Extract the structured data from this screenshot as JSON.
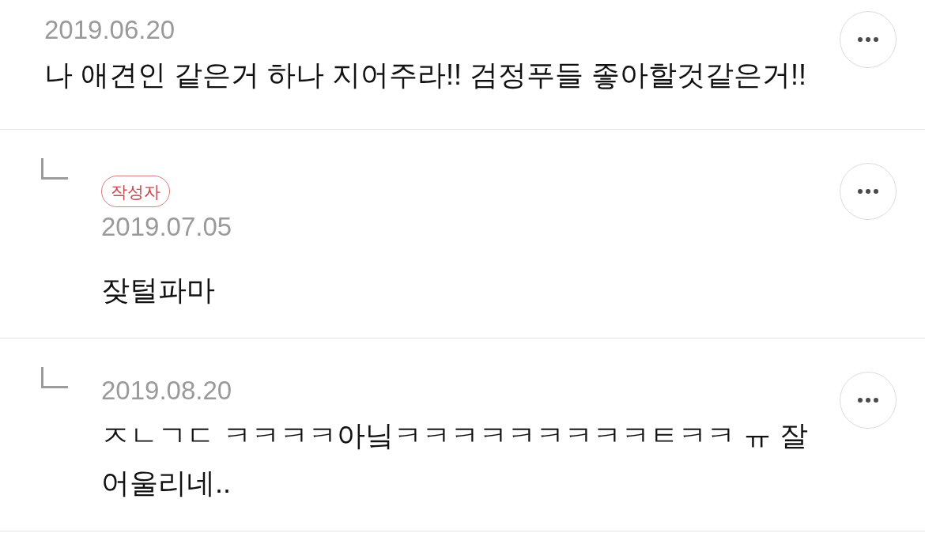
{
  "comments": [
    {
      "kind": "comment",
      "date": "2019.06.20",
      "text": "나 애견인 같은거 하나 지어주라!! 검정푸들 좋아할것같은거!!"
    },
    {
      "kind": "reply",
      "badge": "작성자",
      "date": "2019.07.05",
      "text": "잦털파마"
    },
    {
      "kind": "reply",
      "date": "2019.08.20",
      "text": "ㅈㄴㄱㄷ ㅋㅋㅋㅋ아닠ㅋㅋㅋㅋㅋㅋㅋㅋㅋㅌㅋㅋ ㅠ 잘 어울리네.."
    }
  ]
}
